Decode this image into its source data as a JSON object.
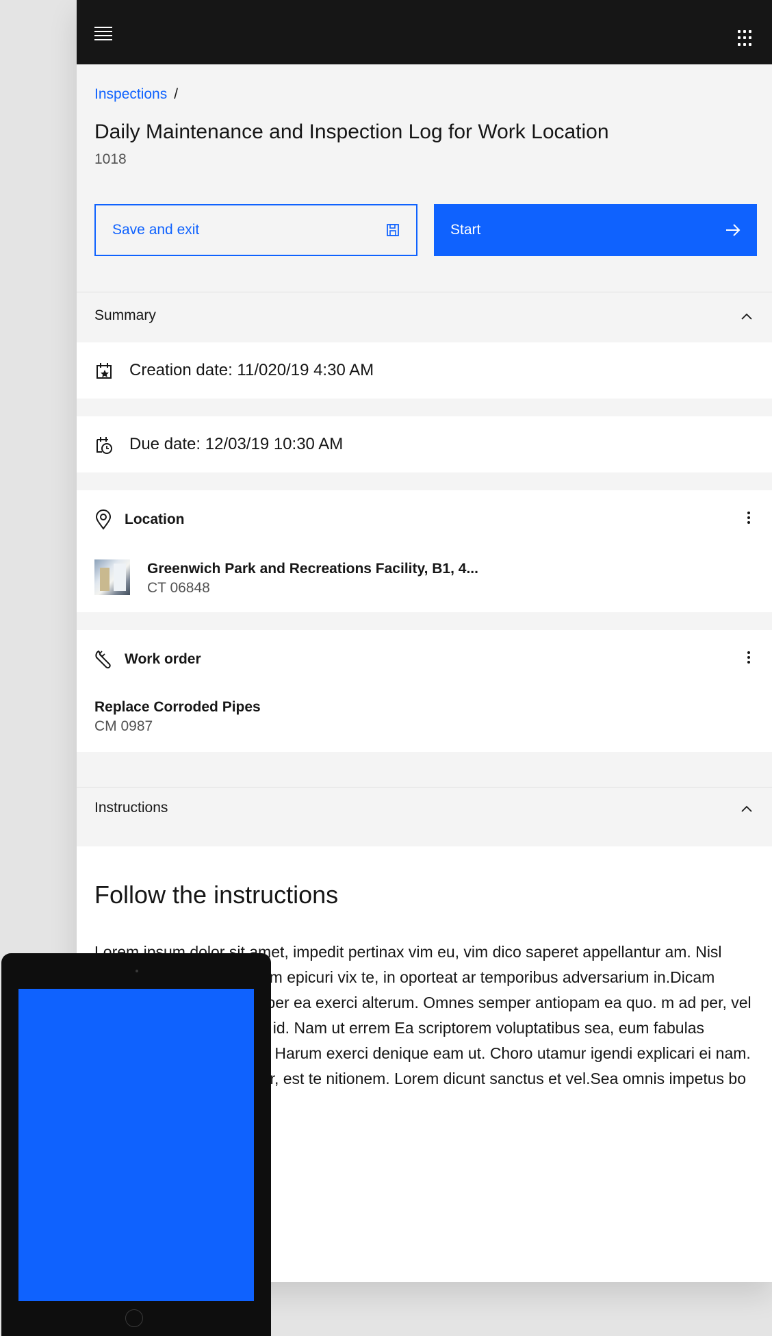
{
  "header": {
    "menu_icon": "hamburger-menu-icon",
    "apps_icon": "app-switcher-icon"
  },
  "breadcrumb": {
    "link": "Inspections",
    "separator": "/"
  },
  "page": {
    "title": "Daily Maintenance and Inspection Log for Work Location",
    "subtitle": "1018"
  },
  "actions": {
    "save_label": "Save and exit",
    "start_label": "Start"
  },
  "summary": {
    "label": "Summary",
    "creation_date": "Creation date: 11/020/19  4:30 AM",
    "due_date": "Due date: 12/03/19  10:30 AM"
  },
  "location": {
    "heading": "Location",
    "name": "Greenwich Park and Recreations Facility, B1, 4...",
    "code": "CT 06848"
  },
  "work_order": {
    "heading": "Work order",
    "name": "Replace Corroded Pipes",
    "code": "CM 0987"
  },
  "instructions": {
    "label": "Instructions",
    "title": "Follow the instructions",
    "body": "Lorem ipsum dolor sit amet, impedit pertinax vim eu, vim dico saperet appellantur am. Nisl natum eruditi eu vis. Quem epicuri vix te, in oporteat ar temporibus adversarium in.Dicam eripuit sit et. Te sea ulis, per ea exerci alterum. Omnes semper antiopam ea quo. m ad per, vel feugiat sanctus minimum id. Nam ut errem Ea scriptorem voluptatibus sea, eum fabulas adipisci rum menandri et. Harum exerci denique eam ut. Choro utamur igendi explicari ei nam. Eos ad senserit efficiantur, est te nitionem. Lorem dicunt sanctus et vel.Sea omnis impetus bo disputationi ex per."
  },
  "colors": {
    "primary": "#0f62fe",
    "header_bg": "#161616",
    "surface": "#f4f4f4"
  }
}
